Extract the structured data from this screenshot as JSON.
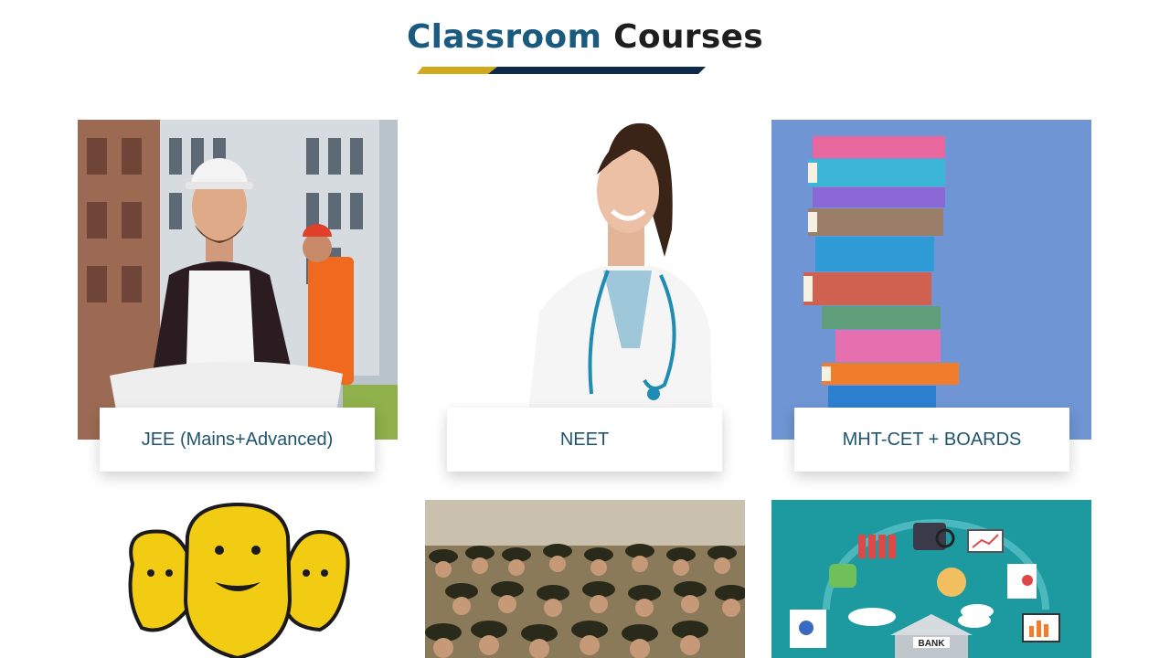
{
  "heading": {
    "accent": "Classroom",
    "rest": "Courses"
  },
  "colors": {
    "accent": "#1a5a7e",
    "gold": "#d4a81c",
    "navy": "#0e2a4a"
  },
  "courses": [
    {
      "label": "JEE (Mains+Advanced)",
      "image": "engineer-photo"
    },
    {
      "label": "NEET",
      "image": "doctor-photo"
    },
    {
      "label": "MHT-CET + BOARDS",
      "image": "books-stack-photo"
    },
    {
      "label": "",
      "image": "national-emblem-lions"
    },
    {
      "label": "",
      "image": "army-officers-saluting-photo"
    },
    {
      "label": "BANK",
      "image": "banking-illustration"
    }
  ]
}
